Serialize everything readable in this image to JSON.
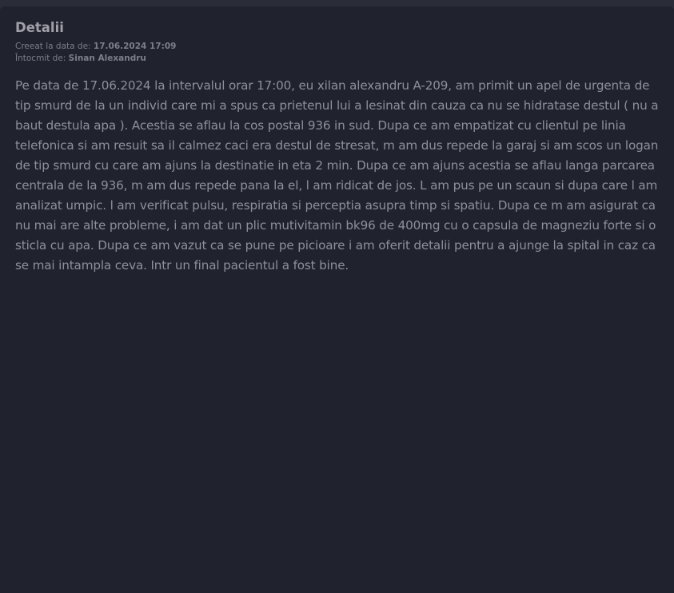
{
  "details": {
    "title": "Detalii",
    "created_label": "Creeat la data de:",
    "created_value": "17.06.2024 17:09",
    "author_label": "Întocmit de:",
    "author_value": "Sinan Alexandru",
    "body": "Pe data de 17.06.2024 la intervalul orar 17:00, eu xilan alexandru A-209, am primit un apel de urgenta de tip smurd de la un individ care mi a spus ca prietenul lui a lesinat din cauza ca nu se hidratase destul ( nu a baut destula apa ). Acestia se aflau la cos postal 936 in sud. Dupa ce am empatizat cu clientul pe linia telefonica si am resuit sa il calmez caci era destul de stresat, m am dus repede la garaj si am scos un logan de tip smurd cu care am ajuns la destinatie in eta 2 min. Dupa ce am ajuns acestia se aflau langa parcarea centrala de la 936, m am dus repede pana la el, l am ridicat de jos. L am pus pe un scaun si dupa care l am analizat umpic. l am verificat pulsu, respiratia si perceptia asupra timp si spatiu. Dupa ce m am asigurat ca nu mai are alte probleme, i am dat un plic mutivitamin bk96 de 400mg cu o capsula de magneziu forte si o sticla cu apa. Dupa ce am vazut ca se pune pe picioare i am oferit detalii pentru a ajunge la spital in caz ca se mai intampla ceva. Intr un final pacientul a fost bine."
  }
}
